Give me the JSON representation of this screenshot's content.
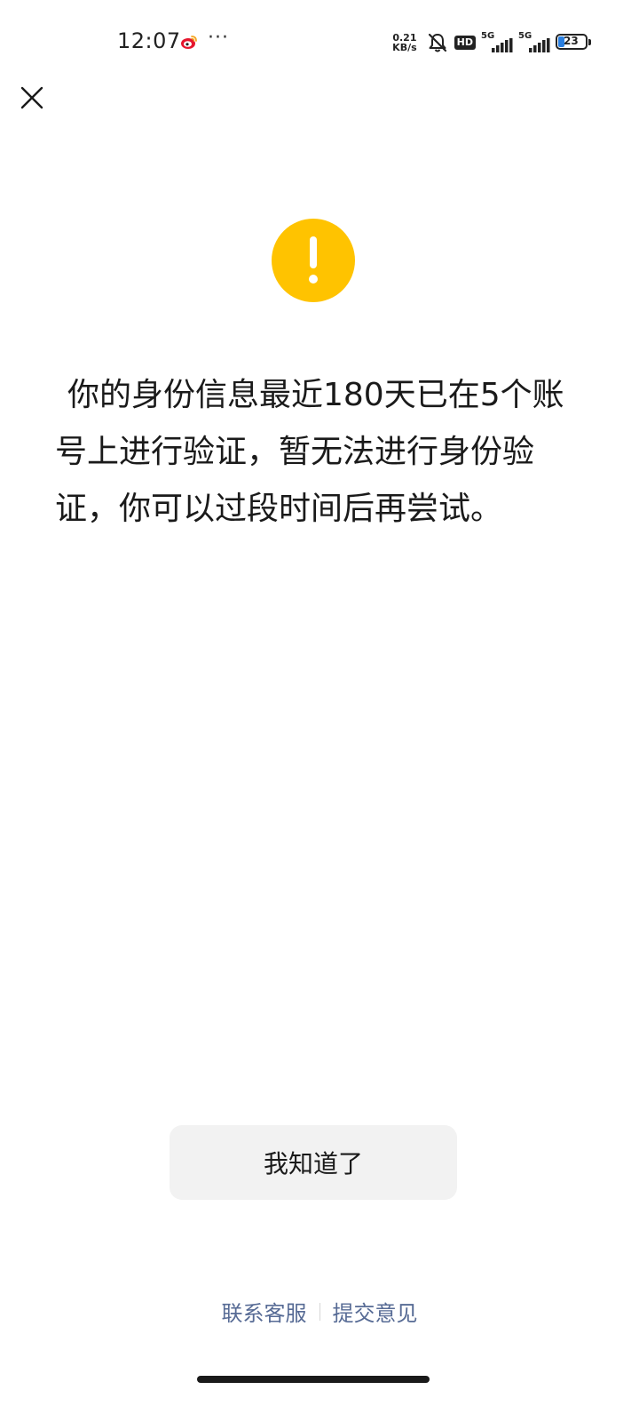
{
  "status_bar": {
    "time": "12:07",
    "more": "···",
    "net_speed_value": "0.21",
    "net_speed_unit": "KB/s",
    "hd_label": "HD",
    "signal1_label": "5G",
    "signal2_label": "5G",
    "battery_level": "23",
    "battery_fraction": 0.23,
    "battery_color": "#2a7fe0"
  },
  "dialog": {
    "message": "你的身份信息最近180天已在5个账号上进行验证，暂无法进行身份验证，你可以过段时间后再尝试。",
    "warning_color": "#ffc300",
    "confirm_label": "我知道了"
  },
  "footer": {
    "contact_label": "联系客服",
    "feedback_label": "提交意见",
    "link_color": "#576b95"
  }
}
